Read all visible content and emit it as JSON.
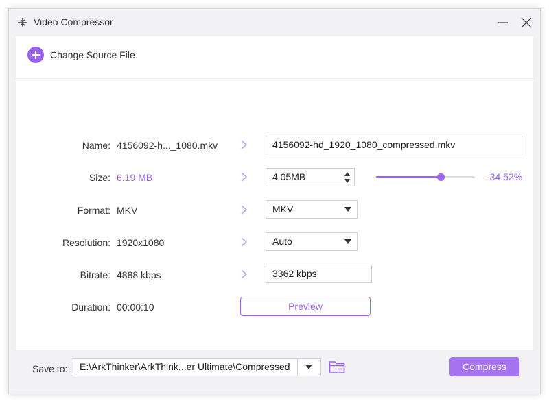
{
  "window": {
    "title": "Video Compressor",
    "icons": {
      "app": "compress-icon",
      "minimize": "minimize-icon",
      "close": "close-icon"
    }
  },
  "toolbar": {
    "change_source_label": "Change Source File",
    "icon": "plus-circle-icon"
  },
  "colors": {
    "accent": "#9b62ee",
    "compress_button": "#a674f0",
    "window_bg": "#f2f2f5"
  },
  "rows": {
    "name": {
      "label": "Name:",
      "source": "4156092-h..._1080.mkv",
      "output": "4156092-hd_1920_1080_compressed.mkv"
    },
    "size": {
      "label": "Size:",
      "source": "6.19 MB",
      "output": "4.05MB",
      "reduction_text": "-34.52%",
      "slider_fraction": 0.6548
    },
    "format": {
      "label": "Format:",
      "source": "MKV",
      "output": "MKV"
    },
    "resolution": {
      "label": "Resolution:",
      "source": "1920x1080",
      "output": "Auto"
    },
    "bitrate": {
      "label": "Bitrate:",
      "source": "4888 kbps",
      "output": "3362 kbps"
    },
    "duration": {
      "label": "Duration:",
      "source": "00:00:10"
    }
  },
  "preview_label": "Preview",
  "footer": {
    "save_to_label": "Save to:",
    "save_path": "E:\\ArkThinker\\ArkThink...er Ultimate\\Compressed",
    "folder_icon": "folder-icon",
    "compress_label": "Compress"
  }
}
